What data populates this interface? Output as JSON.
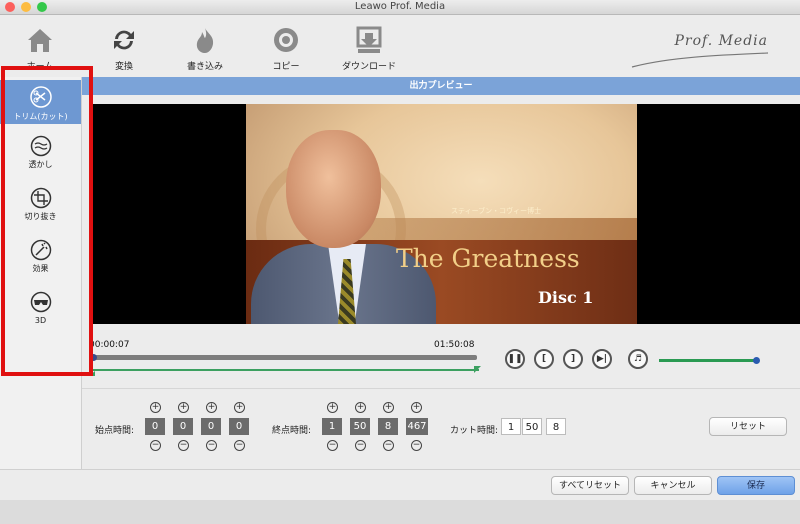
{
  "window": {
    "title": "Leawo Prof. Media"
  },
  "toolbar": {
    "items": [
      {
        "label": "ホーム",
        "icon": "home-icon"
      },
      {
        "label": "変換",
        "icon": "convert-icon"
      },
      {
        "label": "書き込み",
        "icon": "burn-icon"
      },
      {
        "label": "コピー",
        "icon": "copy-icon"
      },
      {
        "label": "ダウンロード",
        "icon": "download-icon"
      }
    ],
    "logo": "Prof. Media"
  },
  "sidebar": {
    "items": [
      {
        "label": "トリム(カット)",
        "icon": "trim-icon",
        "active": true
      },
      {
        "label": "透かし",
        "icon": "watermark-icon"
      },
      {
        "label": "切り抜き",
        "icon": "crop-icon"
      },
      {
        "label": "効果",
        "icon": "effect-icon"
      },
      {
        "label": "3D",
        "icon": "3d-glasses-icon"
      }
    ]
  },
  "preview": {
    "header": "出力プレビュー",
    "video_subtitle": "スティーブン・コヴィー博士",
    "video_title": "The Greatness",
    "video_disc": "Disc 1"
  },
  "timeline": {
    "current_time": "00:00:07",
    "end_time": "01:50:08"
  },
  "trim": {
    "start_label": "始点時間:",
    "start_values": [
      "0",
      "0",
      "0",
      "0"
    ],
    "end_label": "終点時間:",
    "end_values": [
      "1",
      "50",
      "8",
      "467"
    ],
    "duration_label": "カット時間:",
    "duration_values": [
      "1",
      "50",
      "8"
    ],
    "reset_label": "リセット"
  },
  "footer": {
    "reset_all": "すべてリセット",
    "cancel": "キャンセル",
    "save": "保存"
  },
  "colors": {
    "accent": "#6e98d2",
    "highlight_box": "#e01010",
    "green": "#3ca060"
  }
}
